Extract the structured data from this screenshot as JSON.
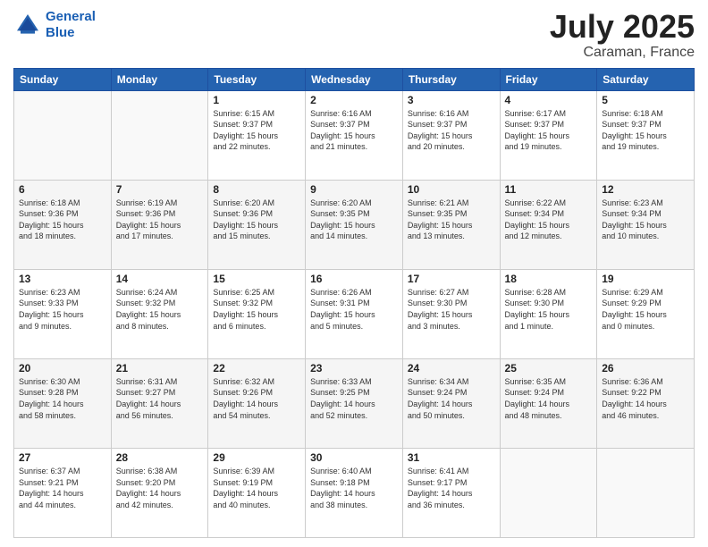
{
  "header": {
    "logo_line1": "General",
    "logo_line2": "Blue",
    "month": "July 2025",
    "location": "Caraman, France"
  },
  "weekdays": [
    "Sunday",
    "Monday",
    "Tuesday",
    "Wednesday",
    "Thursday",
    "Friday",
    "Saturday"
  ],
  "weeks": [
    [
      {
        "day": "",
        "info": ""
      },
      {
        "day": "",
        "info": ""
      },
      {
        "day": "1",
        "info": "Sunrise: 6:15 AM\nSunset: 9:37 PM\nDaylight: 15 hours\nand 22 minutes."
      },
      {
        "day": "2",
        "info": "Sunrise: 6:16 AM\nSunset: 9:37 PM\nDaylight: 15 hours\nand 21 minutes."
      },
      {
        "day": "3",
        "info": "Sunrise: 6:16 AM\nSunset: 9:37 PM\nDaylight: 15 hours\nand 20 minutes."
      },
      {
        "day": "4",
        "info": "Sunrise: 6:17 AM\nSunset: 9:37 PM\nDaylight: 15 hours\nand 19 minutes."
      },
      {
        "day": "5",
        "info": "Sunrise: 6:18 AM\nSunset: 9:37 PM\nDaylight: 15 hours\nand 19 minutes."
      }
    ],
    [
      {
        "day": "6",
        "info": "Sunrise: 6:18 AM\nSunset: 9:36 PM\nDaylight: 15 hours\nand 18 minutes."
      },
      {
        "day": "7",
        "info": "Sunrise: 6:19 AM\nSunset: 9:36 PM\nDaylight: 15 hours\nand 17 minutes."
      },
      {
        "day": "8",
        "info": "Sunrise: 6:20 AM\nSunset: 9:36 PM\nDaylight: 15 hours\nand 15 minutes."
      },
      {
        "day": "9",
        "info": "Sunrise: 6:20 AM\nSunset: 9:35 PM\nDaylight: 15 hours\nand 14 minutes."
      },
      {
        "day": "10",
        "info": "Sunrise: 6:21 AM\nSunset: 9:35 PM\nDaylight: 15 hours\nand 13 minutes."
      },
      {
        "day": "11",
        "info": "Sunrise: 6:22 AM\nSunset: 9:34 PM\nDaylight: 15 hours\nand 12 minutes."
      },
      {
        "day": "12",
        "info": "Sunrise: 6:23 AM\nSunset: 9:34 PM\nDaylight: 15 hours\nand 10 minutes."
      }
    ],
    [
      {
        "day": "13",
        "info": "Sunrise: 6:23 AM\nSunset: 9:33 PM\nDaylight: 15 hours\nand 9 minutes."
      },
      {
        "day": "14",
        "info": "Sunrise: 6:24 AM\nSunset: 9:32 PM\nDaylight: 15 hours\nand 8 minutes."
      },
      {
        "day": "15",
        "info": "Sunrise: 6:25 AM\nSunset: 9:32 PM\nDaylight: 15 hours\nand 6 minutes."
      },
      {
        "day": "16",
        "info": "Sunrise: 6:26 AM\nSunset: 9:31 PM\nDaylight: 15 hours\nand 5 minutes."
      },
      {
        "day": "17",
        "info": "Sunrise: 6:27 AM\nSunset: 9:30 PM\nDaylight: 15 hours\nand 3 minutes."
      },
      {
        "day": "18",
        "info": "Sunrise: 6:28 AM\nSunset: 9:30 PM\nDaylight: 15 hours\nand 1 minute."
      },
      {
        "day": "19",
        "info": "Sunrise: 6:29 AM\nSunset: 9:29 PM\nDaylight: 15 hours\nand 0 minutes."
      }
    ],
    [
      {
        "day": "20",
        "info": "Sunrise: 6:30 AM\nSunset: 9:28 PM\nDaylight: 14 hours\nand 58 minutes."
      },
      {
        "day": "21",
        "info": "Sunrise: 6:31 AM\nSunset: 9:27 PM\nDaylight: 14 hours\nand 56 minutes."
      },
      {
        "day": "22",
        "info": "Sunrise: 6:32 AM\nSunset: 9:26 PM\nDaylight: 14 hours\nand 54 minutes."
      },
      {
        "day": "23",
        "info": "Sunrise: 6:33 AM\nSunset: 9:25 PM\nDaylight: 14 hours\nand 52 minutes."
      },
      {
        "day": "24",
        "info": "Sunrise: 6:34 AM\nSunset: 9:24 PM\nDaylight: 14 hours\nand 50 minutes."
      },
      {
        "day": "25",
        "info": "Sunrise: 6:35 AM\nSunset: 9:24 PM\nDaylight: 14 hours\nand 48 minutes."
      },
      {
        "day": "26",
        "info": "Sunrise: 6:36 AM\nSunset: 9:22 PM\nDaylight: 14 hours\nand 46 minutes."
      }
    ],
    [
      {
        "day": "27",
        "info": "Sunrise: 6:37 AM\nSunset: 9:21 PM\nDaylight: 14 hours\nand 44 minutes."
      },
      {
        "day": "28",
        "info": "Sunrise: 6:38 AM\nSunset: 9:20 PM\nDaylight: 14 hours\nand 42 minutes."
      },
      {
        "day": "29",
        "info": "Sunrise: 6:39 AM\nSunset: 9:19 PM\nDaylight: 14 hours\nand 40 minutes."
      },
      {
        "day": "30",
        "info": "Sunrise: 6:40 AM\nSunset: 9:18 PM\nDaylight: 14 hours\nand 38 minutes."
      },
      {
        "day": "31",
        "info": "Sunrise: 6:41 AM\nSunset: 9:17 PM\nDaylight: 14 hours\nand 36 minutes."
      },
      {
        "day": "",
        "info": ""
      },
      {
        "day": "",
        "info": ""
      }
    ]
  ]
}
